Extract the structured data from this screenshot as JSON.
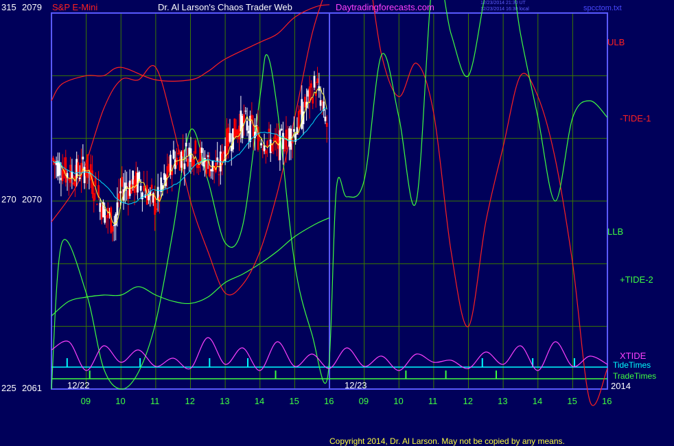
{
  "header": {
    "instrument": "S&P E-Mini",
    "title": "Dr. Al Larson's Chaos Trader Web",
    "site": "Daytradingforecasts.com",
    "stamp_ut": "12/23/2014 21:30 UT",
    "stamp_local": "12/23/2014 16:30 local",
    "file": "spcctom.txt"
  },
  "footer": {
    "copyright": "Copyright 2014, Dr. Al Larson. May not be copied by any means."
  },
  "colors": {
    "background": "#00005a",
    "grid": "#3c7a00",
    "axis": "#5a5aff",
    "ulb": "#ff2020",
    "llb": "#40ff40",
    "tide1": "#ff2020",
    "tide2": "#40ff40",
    "xtide": "#ff40ff",
    "tidetimes": "#00ffff",
    "tradetimes": "#40ff40",
    "price_up": "#ffffff",
    "price_down": "#ff0000",
    "ma_fast": "#ffff40",
    "ma_slow": "#00e0ff"
  },
  "chart_data": {
    "type": "line",
    "title": "S&P E-Mini",
    "y_axis_labels": [
      {
        "tide": "315",
        "price": "2079"
      },
      {
        "tide": "270",
        "price": "2070"
      },
      {
        "tide": "225",
        "price": "2061"
      }
    ],
    "ylim_price": [
      2061,
      2079
    ],
    "ylim_tide": [
      225,
      315
    ],
    "date_labels": [
      "12/22",
      "12/23"
    ],
    "year_label": "2014",
    "hour_labels": [
      "09",
      "10",
      "11",
      "12",
      "13",
      "14",
      "15",
      "16",
      "09",
      "10",
      "11",
      "12",
      "13",
      "14",
      "15",
      "16"
    ],
    "x_hours_range": [
      0,
      16
    ],
    "series_labels": [
      "ULB",
      "-TIDE-1",
      "LLB",
      "+TIDE-2",
      "XTIDE",
      "TideTimes",
      "TradeTimes"
    ],
    "series": [
      {
        "name": "ULB",
        "x": [
          0,
          0.3,
          1,
          1.5,
          2,
          3,
          4,
          4.5,
          5,
          6,
          6.5,
          7,
          7.6,
          8
        ],
        "values": [
          2074.8,
          2075.6,
          2076.0,
          2076.0,
          2076.4,
          2075.8,
          2075.8,
          2076.2,
          2076.8,
          2077.6,
          2078.0,
          2078.8,
          2079.3,
          2079.4
        ]
      },
      {
        "name": "LLB",
        "x": [
          0,
          0.5,
          1,
          1.5,
          2,
          2.5,
          3,
          3.5,
          4,
          4.5,
          5,
          5.5,
          6,
          6.5,
          7,
          7.6,
          8
        ],
        "values": [
          2064.5,
          2065.2,
          2065.4,
          2065.5,
          2065.5,
          2065.9,
          2065.5,
          2065.2,
          2065.1,
          2065.4,
          2066.1,
          2066.5,
          2067.0,
          2067.6,
          2068.3,
          2068.9,
          2069.2
        ]
      },
      {
        "name": "-TIDE-1",
        "x": [
          0,
          0.8,
          1.5,
          2,
          2.5,
          3,
          3.5,
          4,
          4.5,
          5,
          5.5,
          6,
          6.5,
          7,
          7.5,
          7.95,
          8.2,
          8.5,
          9,
          9.5,
          10,
          10.5,
          11,
          11.5,
          12,
          12.5,
          13,
          13.5,
          14,
          14.5,
          15,
          15.5,
          16
        ],
        "values": [
          265,
          275,
          292,
          299,
          299,
          302,
          288,
          270,
          258,
          248,
          250,
          258,
          272,
          290,
          310,
          322,
          330,
          331,
          330,
          305,
          295,
          303,
          291,
          258,
          240,
          265,
          283,
          300,
          295,
          280,
          255,
          222,
          230
        ]
      },
      {
        "name": "+TIDE-2",
        "x": [
          0,
          0.3,
          1,
          1.5,
          2,
          2.5,
          3,
          3.5,
          4,
          4.5,
          5,
          5.5,
          6,
          6.2,
          6.5,
          7,
          7.5,
          7.95,
          8.2,
          8.5,
          9,
          9.5,
          10,
          10.5,
          11,
          11.5,
          12,
          12.5,
          13,
          13.5,
          14,
          14.5,
          15,
          15.5,
          16
        ],
        "values": [
          225,
          260,
          248,
          230,
          225,
          229,
          241,
          263,
          287,
          275,
          260,
          264,
          295,
          305,
          292,
          255,
          238,
          228,
          273,
          271,
          275,
          305,
          290,
          270,
          325,
          310,
          300,
          320,
          335,
          310,
          290,
          270,
          290,
          294,
          290
        ]
      },
      {
        "name": "XTIDE",
        "x": [
          0,
          0.5,
          1,
          1.5,
          2,
          2.5,
          3,
          3.5,
          4,
          4.5,
          5,
          5.5,
          6,
          6.5,
          7,
          7.5,
          8,
          8.5,
          9,
          9.5,
          10,
          10.5,
          11,
          11.5,
          12,
          12.5,
          13,
          13.5,
          14,
          14.5,
          15,
          15.5,
          16
        ],
        "values": [
          1.2,
          1.6,
          0.2,
          1.4,
          0.6,
          1.2,
          0.4,
          0.8,
          0.3,
          1.8,
          0.5,
          1.3,
          0.2,
          1.6,
          0.4,
          1.0,
          0.3,
          1.3,
          0.4,
          0.9,
          0.2,
          1.0,
          0.6,
          0.7,
          0.3,
          1.1,
          0.5,
          1.4,
          0.2,
          1.6,
          0.4,
          0.9,
          0.5
        ]
      },
      {
        "name": "Price",
        "x": [
          0,
          0.5,
          1,
          1.5,
          1.8,
          2,
          2.5,
          3,
          3.5,
          4,
          4.5,
          4.8,
          5,
          5.5,
          6,
          6.5,
          7,
          7.3,
          7.6,
          7.8,
          7.95
        ],
        "values": [
          2072.0,
          2071.2,
          2071.6,
          2069.5,
          2068.9,
          2070.6,
          2070.9,
          2069.8,
          2072.0,
          2072.4,
          2071.8,
          2071.4,
          2072.8,
          2073.8,
          2073.0,
          2072.6,
          2073.4,
          2074.6,
          2075.6,
          2074.4,
          2073.4
        ]
      }
    ],
    "tide_times_hours": [
      0.45,
      2.55,
      4.55,
      5.65,
      12.4,
      13.85,
      15.05
    ],
    "trade_times_hours": [
      1.1,
      6.45,
      10.2,
      11.35,
      12.8
    ]
  }
}
